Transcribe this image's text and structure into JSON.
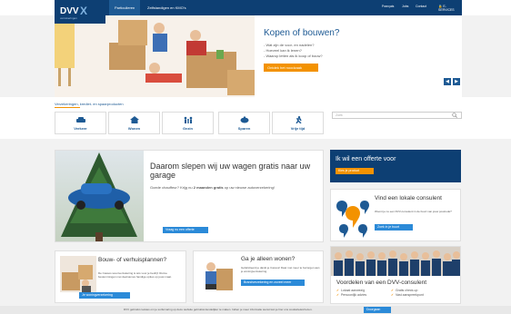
{
  "header": {
    "logo_text": "DVV",
    "logo_mark": "X",
    "logo_sub": "verzekeringen",
    "tabs": [
      {
        "label": "Particulieren"
      },
      {
        "label": "Zelfstandigen en KMO's"
      }
    ],
    "utils": [
      {
        "label": "Français"
      },
      {
        "label": "Jobs"
      },
      {
        "label": "Contact"
      },
      {
        "label": "E-SERVICES"
      }
    ]
  },
  "hero": {
    "title": "Kopen of bouwen?",
    "items": [
      "- Wat zijn de voor- en nadelen?",
      "- Hoeveel kan ik lenen?",
      "- Waarop letten als ik koop of bouw?"
    ],
    "button": "Ontdek het noodzaak"
  },
  "breadcrumb": "Verzekeringen, krediet- en spaarproducten",
  "categories": [
    {
      "label": "Verkeer",
      "icon": "car-icon"
    },
    {
      "label": "Wonen",
      "icon": "house-icon"
    },
    {
      "label": "Gezin",
      "icon": "family-icon"
    },
    {
      "label": "Sparen",
      "icon": "piggy-bank-icon"
    },
    {
      "label": "Vrije tijd",
      "icon": "running-icon"
    }
  ],
  "search": {
    "placeholder": "Zoek"
  },
  "promo": {
    "title": "Daarom slepen wij uw wagen gratis naar uw garage",
    "text_before": "Goede chauffeur? Krijg nu ",
    "text_bold": "2 maanden gratis",
    "text_after": " op uw nieuwe autoverzekering!",
    "button": "Vraag nu een offerte"
  },
  "offer": {
    "title": "Ik wil een offerte voor",
    "button": "Kies je product"
  },
  "consultant": {
    "title": "Vind een lokale consulent",
    "text": "Woont je nu een DVV-consulent in de buurt van jouw postcode?",
    "button": "Zoek in je buurt"
  },
  "moving": {
    "title": "Bouw- of verhuisplannen?",
    "text": "De Cassos woonverzekering is iets voor je bedrijf. Ruime bestemmingen met deelnames handige opties op jouw maat.",
    "button": "Je woningverzekering"
  },
  "alone": {
    "title": "Ga je alleen wonen?",
    "text": "Gefeliciteerd je dankt je Cassos! Daar met meer te bezorgen aan je woningverzekering.",
    "button": "Brandverzekering en zoveel meer"
  },
  "advantages": {
    "title": "Voordelen van een DVV-consulent",
    "col1": [
      "Lokaal aanwezig",
      "Persoonlijk advies"
    ],
    "col2": [
      "Gratis check-up",
      "Vast aanspreekpunt"
    ]
  },
  "cookie": {
    "text": "DVV gebruikt cookies om je surfervaring op deze website gebruiksvriendelijker te maken. Indien je meer informatie wenst kan je hier ons cookiebeleid lezen.",
    "button": "Doorgaan"
  },
  "colors": {
    "brand": "#0d3f73",
    "accent": "#f39200",
    "button": "#2b8ad8"
  }
}
